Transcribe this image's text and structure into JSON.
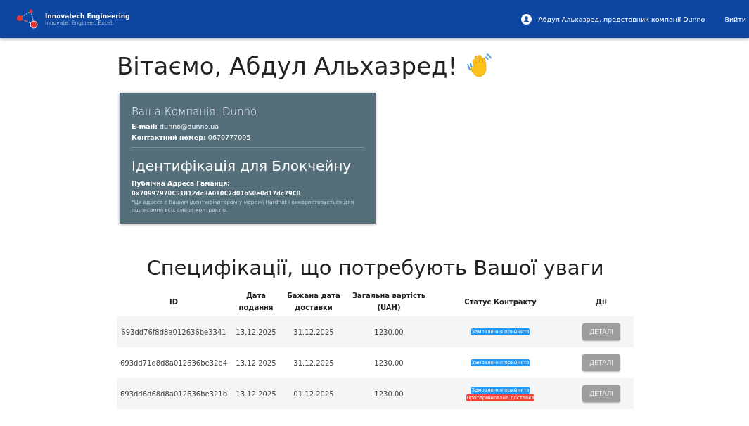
{
  "header": {
    "brand": "Innovatech Engineering",
    "tagline": "Innovate. Engineer. Excel.",
    "user": "Абдул Альхазред, представник компанії Dunno",
    "logout": "Вийти"
  },
  "greeting": "Вітаємо, Абдул Альхазред!",
  "company_card": {
    "company": "Ваша Компанія: Dunno",
    "email_label": "E-mail:",
    "email": "dunno@dunno.ua",
    "phone_label": "Контактний номер:",
    "phone": "0670777095",
    "blockchain_title": "Ідентифікація для Блокчейну",
    "wallet_label": "Публічна Адреса Гаманця:",
    "wallet": "0x70997970C51812dc3A010C7d01b50e0d17dc79C8",
    "note": "*Ця адреса є Вашим ідентифікатором у мережі Hardhat і використовується для підписання всіх смарт-контрактів."
  },
  "table": {
    "title": "Специфікації, що потребують Вашої уваги",
    "columns": [
      "ID",
      "Дата подання",
      "Бажана дата доставки",
      "Загальна вартість (UAH)",
      "Статус Контракту",
      "Дії"
    ],
    "rows": [
      {
        "id": "693dd76f8d8a012636be3341",
        "submitted": "13.12.2025",
        "delivery": "31.12.2025",
        "total": "1230.00",
        "statuses": [
          {
            "label": "Замовлення прийнято",
            "kind": "accepted"
          }
        ],
        "action": "ДЕТАЛІ"
      },
      {
        "id": "693dd71d8d8a012636be32b4",
        "submitted": "13.12.2025",
        "delivery": "31.12.2025",
        "total": "1230.00",
        "statuses": [
          {
            "label": "Замовлення прийнято",
            "kind": "accepted"
          }
        ],
        "action": "ДЕТАЛІ"
      },
      {
        "id": "693dd6d68d8a012636be321b",
        "submitted": "13.12.2025",
        "delivery": "01.12.2025",
        "total": "1230.00",
        "statuses": [
          {
            "label": "Замовлення прийнято",
            "kind": "accepted"
          },
          {
            "label": "Протермінована доставка",
            "kind": "overdue"
          }
        ],
        "action": "ДЕТАЛІ"
      }
    ]
  }
}
